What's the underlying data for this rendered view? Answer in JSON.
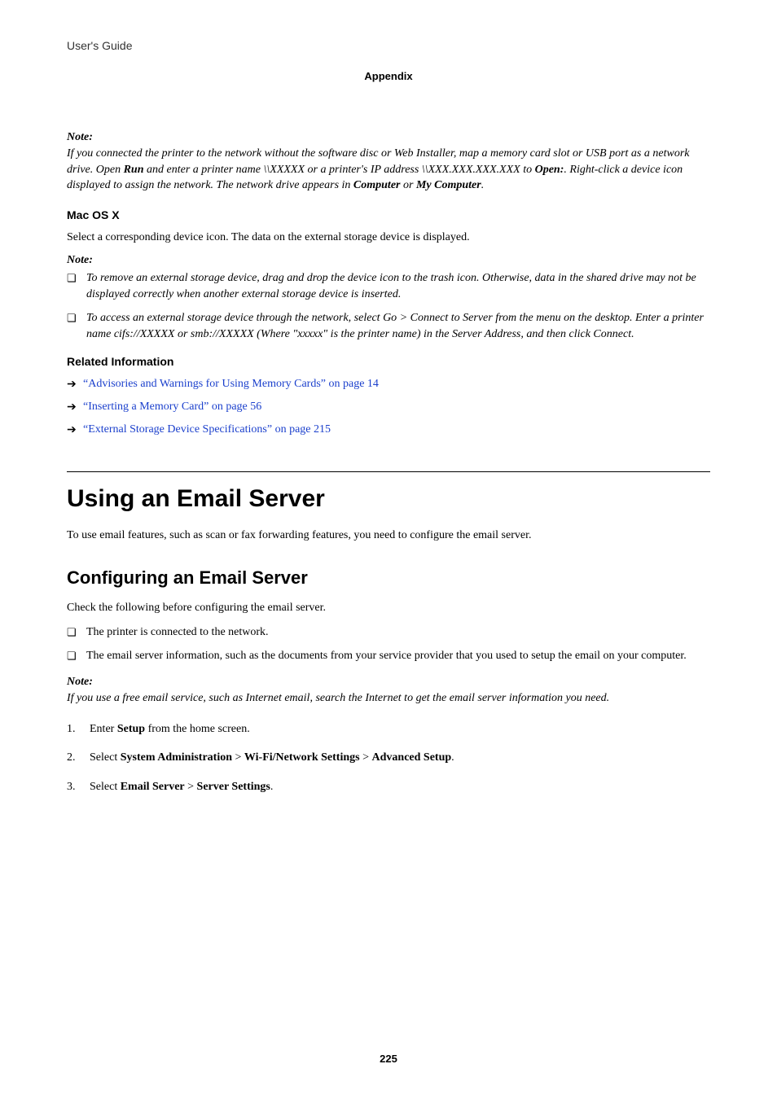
{
  "header": {
    "guide_title": "User's Guide",
    "section": "Appendix"
  },
  "note1": {
    "heading": "Note:",
    "p1_a": "If you connected the printer to the network without the software disc or Web Installer, map a memory card slot or USB port as a network drive. Open ",
    "p1_run": "Run",
    "p1_b": " and enter a printer name \\\\XXXXX or a printer's IP address \\\\XXX.XXX.XXX.XXX to ",
    "p1_open": "Open:",
    "p1_c": ". Right-click a device icon displayed to assign the network. The network drive appears in ",
    "p1_comp": "Computer",
    "p1_d": " or ",
    "p1_mycomp": "My Computer",
    "p1_e": "."
  },
  "macosx": {
    "heading": "Mac OS X",
    "body": "Select a corresponding device icon. The data on the external storage device is displayed."
  },
  "note2": {
    "heading": "Note:",
    "li1": "To remove an external storage device, drag and drop the device icon to the trash icon. Otherwise, data in the shared drive may not be displayed correctly when another external storage device is inserted.",
    "li2_a": "To access an external storage device through the network, select ",
    "li2_go": "Go",
    "li2_b": " > ",
    "li2_cts": "Connect to Server",
    "li2_c": " from the menu on the desktop. Enter a printer name cifs://XXXXX or smb://XXXXX (Where \"xxxxx\" is the printer name) in the ",
    "li2_sa": "Server Address",
    "li2_d": ", and then click ",
    "li2_connect": "Connect",
    "li2_e": "."
  },
  "related": {
    "heading": "Related Information",
    "link1": "“Advisories and Warnings for Using Memory Cards” on page 14",
    "link2": "“Inserting a Memory Card” on page 56",
    "link3": "“External Storage Device Specifications” on page 215"
  },
  "h1": "Using an Email Server",
  "h1_body": "To use email features, such as scan or fax forwarding features, you need to configure the email server.",
  "h2": "Configuring an Email Server",
  "h2_body": "Check the following before configuring the email server.",
  "h2_bullets": {
    "li1": "The printer is connected to the network.",
    "li2": "The email server information, such as the documents from your service provider that you used to setup the email on your computer."
  },
  "note3": {
    "heading": "Note:",
    "text": "If you use a free email service, such as Internet email, search the Internet to get the email server information you need."
  },
  "steps": {
    "li1_a": "Enter ",
    "li1_setup": "Setup",
    "li1_b": " from the home screen.",
    "li2_a": "Select ",
    "li2_sa": "System Administration",
    "li2_b": " > ",
    "li2_wns": "Wi-Fi/Network Settings",
    "li2_c": " > ",
    "li2_as": "Advanced Setup",
    "li2_d": ".",
    "li3_a": "Select ",
    "li3_es": "Email Server",
    "li3_b": " > ",
    "li3_ss": "Server Settings",
    "li3_c": "."
  },
  "page_number": "225"
}
